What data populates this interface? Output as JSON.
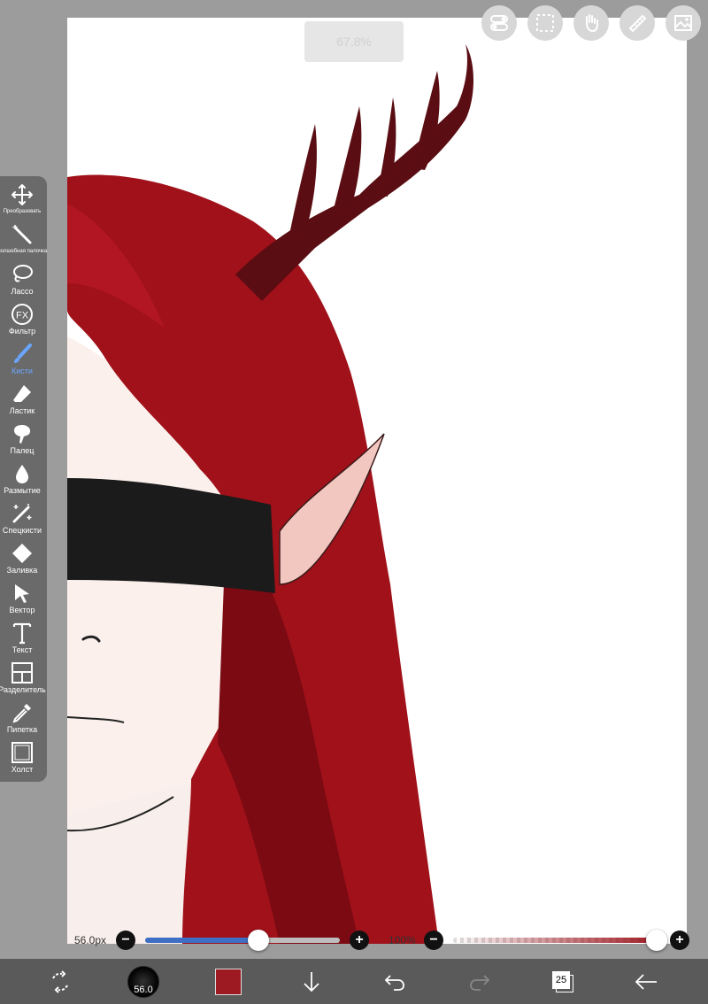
{
  "zoom": {
    "label": "67.8%"
  },
  "toolbar": {
    "tools": [
      {
        "label": "Преобразовать",
        "icon": "move-icon"
      },
      {
        "label": "Волшебная палочка",
        "icon": "magic-wand-icon"
      },
      {
        "label": "Лассо",
        "icon": "lasso-icon"
      },
      {
        "label": "Фильтр",
        "icon": "fx-icon"
      },
      {
        "label": "Кисти",
        "icon": "brush-icon",
        "active": true
      },
      {
        "label": "Ластик",
        "icon": "eraser-icon"
      },
      {
        "label": "Палец",
        "icon": "smudge-icon"
      },
      {
        "label": "Размытие",
        "icon": "blur-drop-icon"
      },
      {
        "label": "Спецкисти",
        "icon": "special-brush-icon"
      },
      {
        "label": "Заливка",
        "icon": "fill-bucket-icon"
      },
      {
        "label": "Вектор",
        "icon": "vector-cursor-icon"
      },
      {
        "label": "Текст",
        "icon": "text-icon"
      },
      {
        "label": "Разделитель",
        "icon": "divider-icon"
      },
      {
        "label": "Пипетка",
        "icon": "eyedropper-icon"
      },
      {
        "label": "Холст",
        "icon": "canvas-icon"
      }
    ]
  },
  "brush_size": {
    "label": "56.0px",
    "value": 56.0,
    "fill_fraction": 0.58
  },
  "opacity": {
    "label": "100%",
    "value": 100
  },
  "bottom": {
    "brush_preview_label": "56.0",
    "layers_count": "25",
    "current_color": "#9e1a22"
  },
  "colors": {
    "accent": "#3f6fc4",
    "hair": "#9e0f16",
    "active_tool": "#6aa5ff"
  }
}
